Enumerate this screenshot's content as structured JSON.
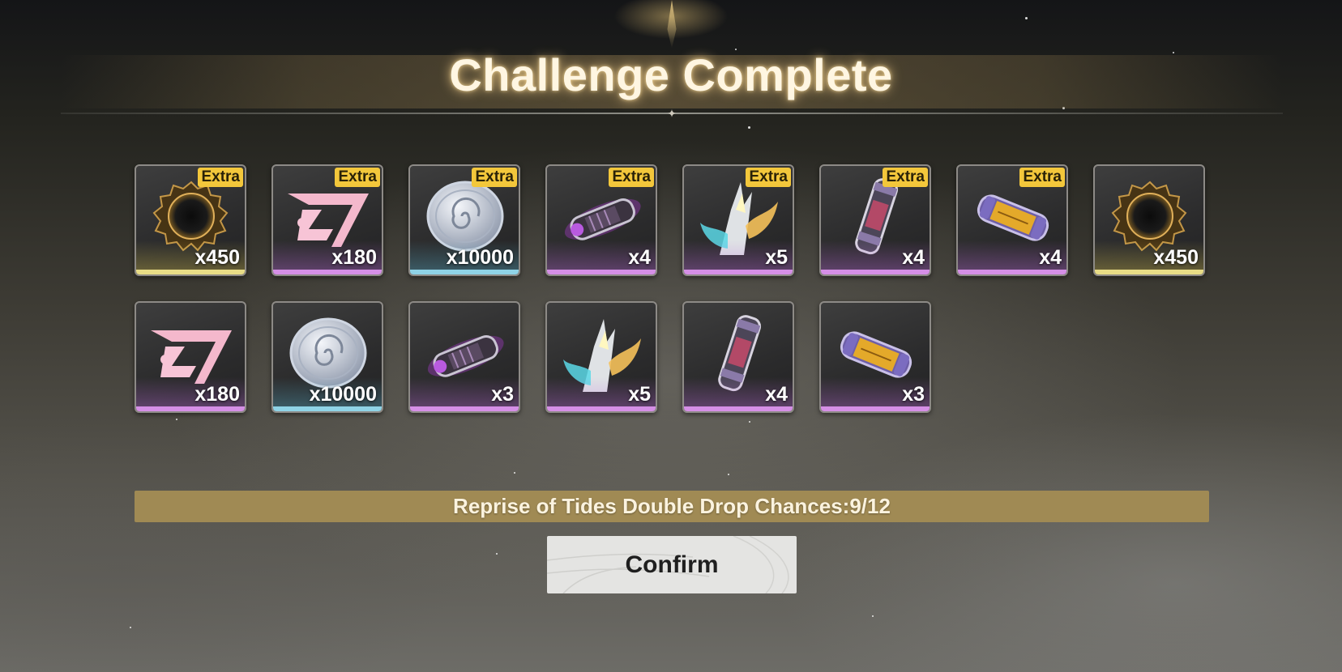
{
  "header": {
    "title": "Challenge Complete"
  },
  "rewards": [
    {
      "name": "black-ring-shell",
      "icon": "dark-ring-icon",
      "quantity": "x450",
      "badge": "Extra",
      "rarity": "gold"
    },
    {
      "name": "pink-tuner",
      "icon": "pink-emblem-icon",
      "quantity": "x180",
      "badge": "Extra",
      "rarity": "purple"
    },
    {
      "name": "silver-coin",
      "icon": "shell-coin-icon",
      "quantity": "x10000",
      "badge": "Extra",
      "rarity": "blue"
    },
    {
      "name": "purple-capsule",
      "icon": "energy-capsule-icon",
      "quantity": "x4",
      "badge": "Extra",
      "rarity": "purple"
    },
    {
      "name": "crystal-feather",
      "icon": "crystal-flame-icon",
      "quantity": "x5",
      "badge": "Extra",
      "rarity": "purple"
    },
    {
      "name": "potion-vial",
      "icon": "tube-vial-icon",
      "quantity": "x4",
      "badge": "Extra",
      "rarity": "purple"
    },
    {
      "name": "gold-cylinder",
      "icon": "gold-cylinder-icon",
      "quantity": "x4",
      "badge": "Extra",
      "rarity": "purple"
    },
    {
      "name": "black-ring-shell",
      "icon": "dark-ring-icon",
      "quantity": "x450",
      "badge": "",
      "rarity": "gold"
    },
    {
      "name": "pink-tuner",
      "icon": "pink-emblem-icon",
      "quantity": "x180",
      "badge": "",
      "rarity": "purple"
    },
    {
      "name": "silver-coin",
      "icon": "shell-coin-icon",
      "quantity": "x10000",
      "badge": "",
      "rarity": "blue"
    },
    {
      "name": "purple-capsule",
      "icon": "energy-capsule-icon",
      "quantity": "x3",
      "badge": "",
      "rarity": "purple"
    },
    {
      "name": "crystal-feather",
      "icon": "crystal-flame-icon",
      "quantity": "x5",
      "badge": "",
      "rarity": "purple"
    },
    {
      "name": "potion-vial",
      "icon": "tube-vial-icon",
      "quantity": "x4",
      "badge": "",
      "rarity": "purple"
    },
    {
      "name": "gold-cylinder",
      "icon": "gold-cylinder-icon",
      "quantity": "x3",
      "badge": "",
      "rarity": "purple"
    }
  ],
  "drop_banner": {
    "text": "Reprise of Tides Double Drop Chances:9/12"
  },
  "confirm_button": {
    "label": "Confirm"
  },
  "colors": {
    "gold_rarity": "#e8dc86",
    "purple_rarity": "#d58fe6",
    "blue_rarity": "#8fd3e6",
    "badge": "#f3c73b",
    "banner": "#a08a54"
  }
}
